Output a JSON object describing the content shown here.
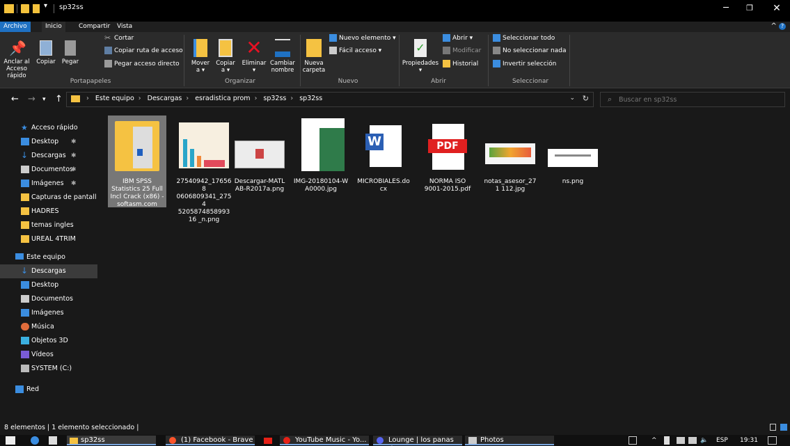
{
  "window": {
    "title": "sp32ss"
  },
  "ribbon_tabs": [
    "Archivo",
    "Inicio",
    "Compartir",
    "Vista"
  ],
  "ribbon": {
    "portapapeles": {
      "label": "Portapapeles",
      "anclar": "Anclar al\nAcceso rápido",
      "copiar": "Copiar",
      "pegar": "Pegar",
      "cortar": "Cortar",
      "copiar_ruta": "Copiar ruta de acceso",
      "pegar_acceso": "Pegar acceso directo"
    },
    "organizar": {
      "label": "Organizar",
      "mover": "Mover\na ▾",
      "copiar_a": "Copiar\na ▾",
      "eliminar": "Eliminar\n▾",
      "cambiar": "Cambiar\nnombre"
    },
    "nuevo": {
      "label": "Nuevo",
      "nueva_carpeta": "Nueva\ncarpeta",
      "nuevo_elemento": "Nuevo elemento ▾",
      "facil_acceso": "Fácil acceso ▾"
    },
    "abrir": {
      "label": "Abrir",
      "propiedades": "Propiedades\n▾",
      "abrir": "Abrir ▾",
      "modificar": "Modificar",
      "historial": "Historial"
    },
    "seleccionar": {
      "label": "Seleccionar",
      "todo": "Seleccionar todo",
      "ninguno": "No seleccionar nada",
      "invertir": "Invertir selección"
    }
  },
  "address": {
    "crumbs": [
      "Este equipo",
      "Descargas",
      "esradistica prom",
      "sp32ss",
      "sp32ss"
    ]
  },
  "search": {
    "placeholder": "Buscar en sp32ss"
  },
  "navpane": {
    "quick_access": "Acceso rápido",
    "quick_items": [
      {
        "label": "Desktop",
        "icon": "desktop-icon",
        "pinned": true
      },
      {
        "label": "Descargas",
        "icon": "download-icon",
        "pinned": true
      },
      {
        "label": "Documentos",
        "icon": "documents-icon",
        "pinned": true
      },
      {
        "label": "Imágenes",
        "icon": "pictures-icon",
        "pinned": true
      },
      {
        "label": "Capturas de pantall",
        "icon": "folder-icon",
        "pinned": false
      },
      {
        "label": "HADRES",
        "icon": "folder-icon",
        "pinned": false
      },
      {
        "label": "temas ingles",
        "icon": "folder-icon",
        "pinned": false
      },
      {
        "label": "UREAL 4TRIM",
        "icon": "folder-icon",
        "pinned": false
      }
    ],
    "this_pc": "Este equipo",
    "pc_items": [
      {
        "label": "Descargas",
        "icon": "download-icon"
      },
      {
        "label": "Desktop",
        "icon": "desktop-icon"
      },
      {
        "label": "Documentos",
        "icon": "documents-icon"
      },
      {
        "label": "Imágenes",
        "icon": "pictures-icon"
      },
      {
        "label": "Música",
        "icon": "music-icon"
      },
      {
        "label": "Objetos 3D",
        "icon": "3d-objects-icon"
      },
      {
        "label": "Vídeos",
        "icon": "videos-icon"
      },
      {
        "label": "SYSTEM (C:)",
        "icon": "drive-icon"
      }
    ],
    "network": "Red"
  },
  "files": [
    {
      "name": "IBM SPSS Statistics 25 Full Incl Crack (x86) - softasm.com",
      "type": "folder",
      "selected": true
    },
    {
      "name": "27540942_176568 0606809341_2754 520587485899316 _n.png",
      "type": "image-infographic"
    },
    {
      "name": "Descargar-MATL AB-R2017a.png",
      "type": "image-screenshot"
    },
    {
      "name": "IMG-20180104-W A0000.jpg",
      "type": "image-green"
    },
    {
      "name": "MICROBIALES.do cx",
      "type": "word"
    },
    {
      "name": "NORMA ISO 9001-2015.pdf",
      "type": "pdf"
    },
    {
      "name": "notas_asesor_271 112.jpg",
      "type": "image-diagram"
    },
    {
      "name": "ns.png",
      "type": "image-doc"
    }
  ],
  "status": {
    "text": "8 elementos  |  1 elemento seleccionado  |"
  },
  "taskbar": {
    "apps": [
      "sp32ss",
      "(1) Facebook - Brave",
      "YouTube Music - Yo...",
      "Lounge | los panas d...",
      "Photos"
    ],
    "lang": "ESP",
    "time": "19:31"
  },
  "colors": {
    "accent": "#1f71c3",
    "folder": "#f5c242",
    "pdf_red": "#e02020",
    "word_blue": "#2b5fb4"
  }
}
